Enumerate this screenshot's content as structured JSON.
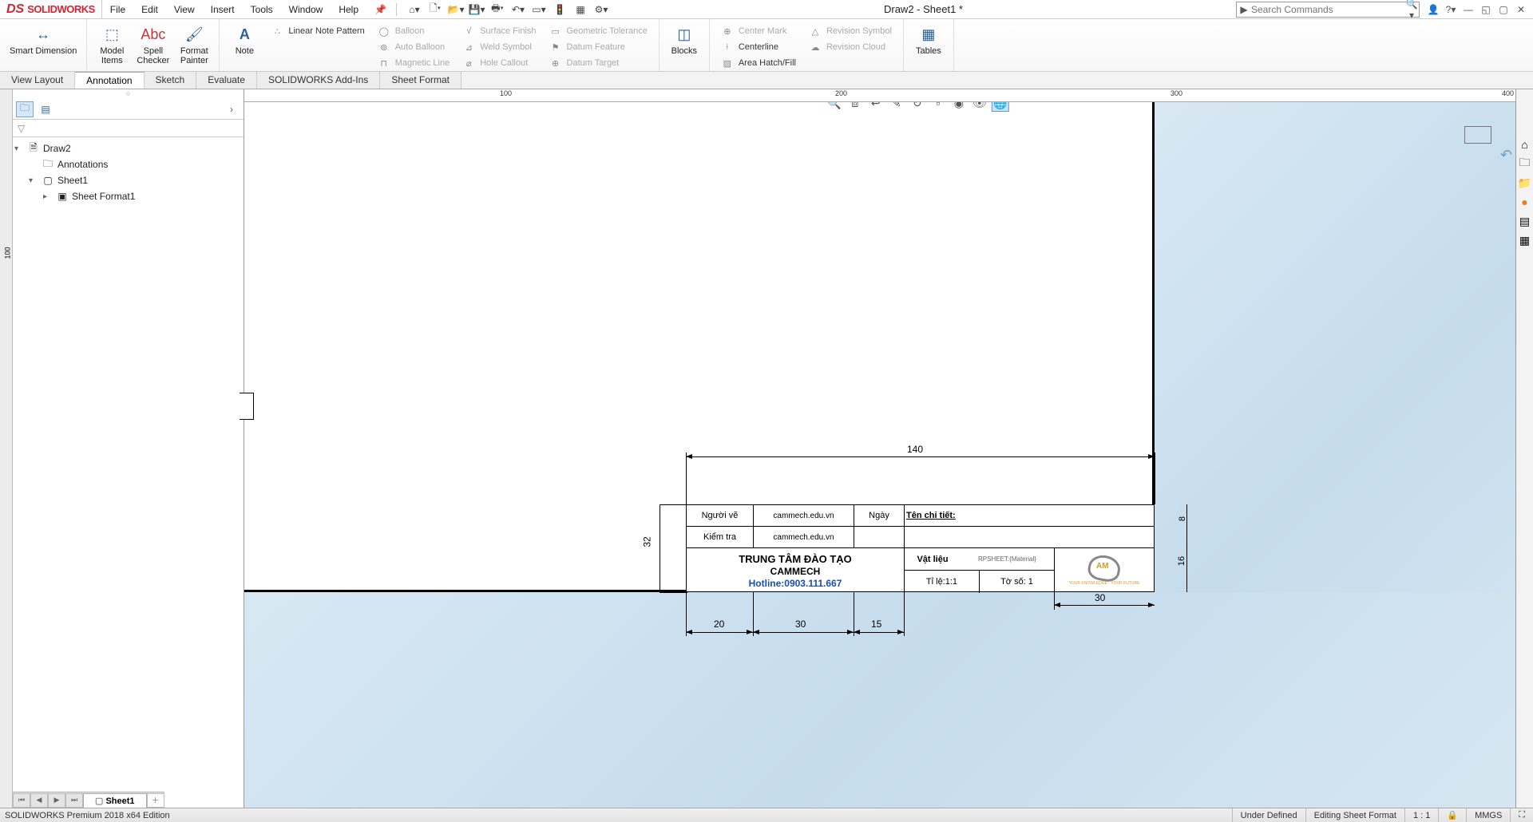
{
  "app": {
    "name": "SOLIDWORKS",
    "logo_glyph": "DS"
  },
  "menu": {
    "file": "File",
    "edit": "Edit",
    "view": "View",
    "insert": "Insert",
    "tools": "Tools",
    "window": "Window",
    "help": "Help"
  },
  "title": "Draw2 - Sheet1 *",
  "search": {
    "placeholder": "Search Commands"
  },
  "ribbon": {
    "smart_dimension": "Smart Dimension",
    "model_items": "Model\nItems",
    "spell_checker": "Spell\nChecker",
    "format_painter": "Format\nPainter",
    "note": "Note",
    "linear_note_pattern": "Linear Note Pattern",
    "balloon": "Balloon",
    "auto_balloon": "Auto Balloon",
    "magnetic_line": "Magnetic Line",
    "surface_finish": "Surface Finish",
    "weld_symbol": "Weld Symbol",
    "hole_callout": "Hole Callout",
    "geometric_tolerance": "Geometric Tolerance",
    "datum_feature": "Datum Feature",
    "datum_target": "Datum Target",
    "blocks": "Blocks",
    "center_mark": "Center Mark",
    "centerline": "Centerline",
    "area_hatch": "Area Hatch/Fill",
    "revision_symbol": "Revision Symbol",
    "revision_cloud": "Revision Cloud",
    "tables": "Tables"
  },
  "feature_tabs": {
    "view_layout": "View Layout",
    "annotation": "Annotation",
    "sketch": "Sketch",
    "evaluate": "Evaluate",
    "addins": "SOLIDWORKS Add-Ins",
    "sheet_format": "Sheet Format"
  },
  "tree": {
    "root": "Draw2",
    "annotations": "Annotations",
    "sheet": "Sheet1",
    "sheet_format": "Sheet Format1"
  },
  "ruler": {
    "t100": "100",
    "t200": "200",
    "t300": "300",
    "t400": "400"
  },
  "titleblock": {
    "dim_top": "140",
    "dim_left": "32",
    "dim_20": "20",
    "dim_30a": "30",
    "dim_15": "15",
    "dim_30b": "30",
    "dim_8": "8",
    "dim_16": "16",
    "nguoi_ve_lbl": "Người vẽ",
    "nguoi_ve_val": "cammech.edu.vn",
    "kiem_tra_lbl": "Kiểm tra",
    "kiem_tra_val": "cammech.edu.vn",
    "ngay_lbl": "Ngày",
    "ten_chi_tiet": "Tên chi tiết:",
    "center1": "TRUNG TÂM ĐÀO TẠO",
    "center2": "CAMMECH",
    "hotline": "Hotline:0903.111.667",
    "vat_lieu": "Vật liệu",
    "material_prop": "RPSHEET:{Material}",
    "ti_le": "Tỉ lệ:1:1",
    "to_so": "Tờ số: 1"
  },
  "bottom": {
    "sheet_tab": "Sheet1"
  },
  "status": {
    "edition": "SOLIDWORKS Premium 2018 x64 Edition",
    "under_defined": "Under Defined",
    "editing": "Editing Sheet Format",
    "scale": "1 : 1",
    "units": "MMGS"
  }
}
